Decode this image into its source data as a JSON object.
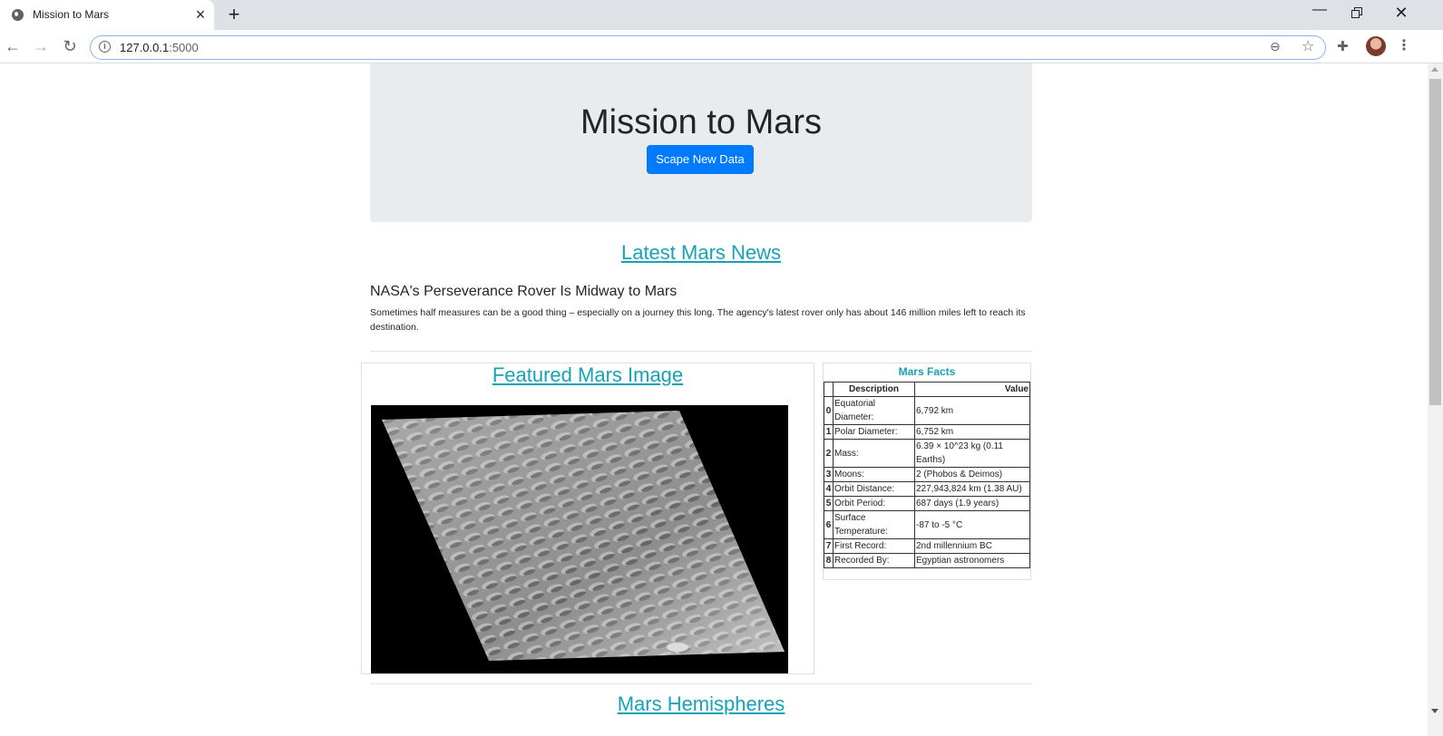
{
  "browser": {
    "tab_title": "Mission to Mars",
    "url_host": "127.0.0.1",
    "url_port": ":5000"
  },
  "header": {
    "title": "Mission to Mars",
    "scrape_button": "Scape New Data"
  },
  "news": {
    "section_title": "Latest Mars News",
    "headline": "NASA's Perseverance Rover Is Midway to Mars",
    "teaser": "Sometimes half measures can be a good thing – especially on a journey this long. The agency's latest rover only has about 146 million miles left to reach its destination."
  },
  "featured_image": {
    "section_title": "Featured Mars Image"
  },
  "facts": {
    "title": "Mars Facts",
    "headers": [
      "",
      "Description",
      "Value"
    ],
    "rows": [
      {
        "idx": "0",
        "description": "Equatorial Diameter:",
        "value": "6,792 km"
      },
      {
        "idx": "1",
        "description": "Polar Diameter:",
        "value": "6,752 km"
      },
      {
        "idx": "2",
        "description": "Mass:",
        "value": "6.39 × 10^23 kg (0.11 Earths)"
      },
      {
        "idx": "3",
        "description": "Moons:",
        "value": "2 (Phobos & Deimos)"
      },
      {
        "idx": "4",
        "description": "Orbit Distance:",
        "value": "227,943,824 km (1.38 AU)"
      },
      {
        "idx": "5",
        "description": "Orbit Period:",
        "value": "687 days (1.9 years)"
      },
      {
        "idx": "6",
        "description": "Surface Temperature:",
        "value": "-87 to -5 °C"
      },
      {
        "idx": "7",
        "description": "First Record:",
        "value": "2nd millennium BC"
      },
      {
        "idx": "8",
        "description": "Recorded By:",
        "value": "Egyptian astronomers"
      }
    ]
  },
  "hemispheres": {
    "section_title": "Mars Hemispheres"
  },
  "colors": {
    "accent": "#17a2b8",
    "button": "#007bff",
    "jumbotron": "#e9ecef"
  }
}
